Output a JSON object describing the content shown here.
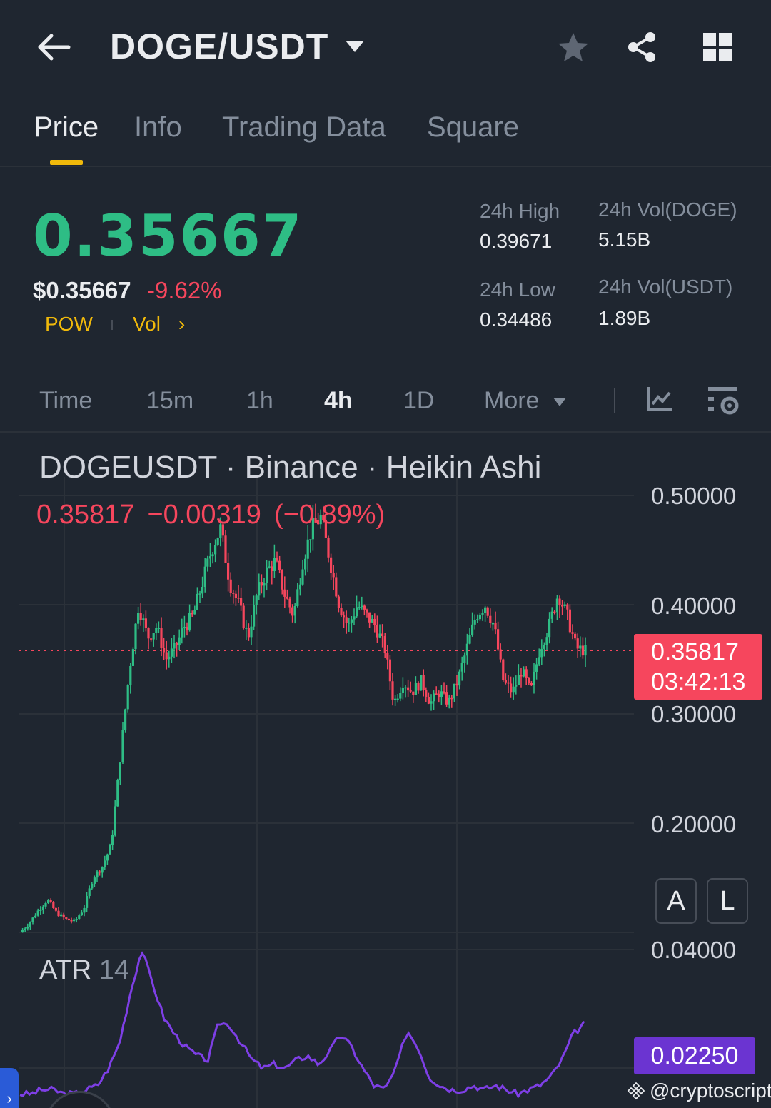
{
  "header": {
    "pair": "DOGE/USDT",
    "icons": [
      "back-arrow-icon",
      "caret-down-icon",
      "star-icon",
      "share-icon",
      "grid-icon"
    ]
  },
  "tabs": [
    {
      "label": "Price",
      "active": true
    },
    {
      "label": "Info",
      "active": false
    },
    {
      "label": "Trading Data",
      "active": false
    },
    {
      "label": "Square",
      "active": false
    }
  ],
  "market": {
    "last_price": "0.35667",
    "usd_price": "$0.35667",
    "change_pct": "-9.62%",
    "tags": {
      "pow": "POW",
      "vol": "Vol",
      "chevron": "›"
    },
    "high_label": "24h High",
    "high_value": "0.39671",
    "low_label": "24h Low",
    "low_value": "0.34486",
    "vol_base_label": "24h Vol(DOGE)",
    "vol_base_value": "5.15B",
    "vol_quote_label": "24h Vol(USDT)",
    "vol_quote_value": "1.89B"
  },
  "intervals": {
    "items": [
      "Time",
      "15m",
      "1h",
      "4h",
      "1D",
      "More"
    ],
    "active": "4h",
    "icons": [
      "indicator-chart-icon",
      "chart-settings-icon"
    ]
  },
  "chart": {
    "title": "DOGEUSDT · Binance · Heikin Ashi",
    "ohlc_close": "0.35817",
    "ohlc_change": "−0.00319",
    "ohlc_change_pct": "(−0.89%)",
    "price_tag_value": "0.35817",
    "price_tag_countdown": "03:42:13",
    "scale_buttons": {
      "auto": "A",
      "log": "L"
    },
    "atr_name": "ATR",
    "atr_length": "14",
    "atr_tag_value": "0.02250",
    "watermark": "@cryptoscript",
    "colors": {
      "up": "#2ebd85",
      "down": "#f6465d",
      "atr": "#7e3fe6",
      "bg": "#1f2630"
    }
  },
  "chart_data": {
    "type": "candlestick",
    "title": "DOGEUSDT · Binance · Heikin Ashi",
    "price_axis_ticks": [
      "0.50000",
      "0.40000",
      "0.30000",
      "0.20000"
    ],
    "atr_axis_ticks": [
      "0.04000"
    ],
    "current_price": 0.35817,
    "price_path": [
      0.1,
      0.108,
      0.12,
      0.13,
      0.118,
      0.112,
      0.11,
      0.122,
      0.15,
      0.16,
      0.18,
      0.26,
      0.34,
      0.4,
      0.37,
      0.38,
      0.35,
      0.36,
      0.38,
      0.39,
      0.42,
      0.45,
      0.47,
      0.42,
      0.4,
      0.37,
      0.41,
      0.43,
      0.44,
      0.41,
      0.39,
      0.44,
      0.47,
      0.48,
      0.44,
      0.4,
      0.38,
      0.4,
      0.39,
      0.38,
      0.36,
      0.31,
      0.33,
      0.32,
      0.33,
      0.31,
      0.32,
      0.31,
      0.33,
      0.36,
      0.39,
      0.4,
      0.38,
      0.33,
      0.32,
      0.34,
      0.32,
      0.36,
      0.38,
      0.41,
      0.39,
      0.36,
      0.358
    ],
    "atr_path": [
      0.006,
      0.006,
      0.007,
      0.007,
      0.006,
      0.006,
      0.007,
      0.008,
      0.012,
      0.018,
      0.03,
      0.04,
      0.032,
      0.024,
      0.02,
      0.017,
      0.015,
      0.014,
      0.023,
      0.022,
      0.018,
      0.014,
      0.012,
      0.013,
      0.012,
      0.014,
      0.015,
      0.013,
      0.016,
      0.02,
      0.017,
      0.012,
      0.008,
      0.007,
      0.012,
      0.021,
      0.017,
      0.01,
      0.008,
      0.007,
      0.007,
      0.008,
      0.007,
      0.008,
      0.007,
      0.006,
      0.007,
      0.008,
      0.01,
      0.014,
      0.02,
      0.0225
    ],
    "ylim": [
      0.08,
      0.52
    ]
  }
}
